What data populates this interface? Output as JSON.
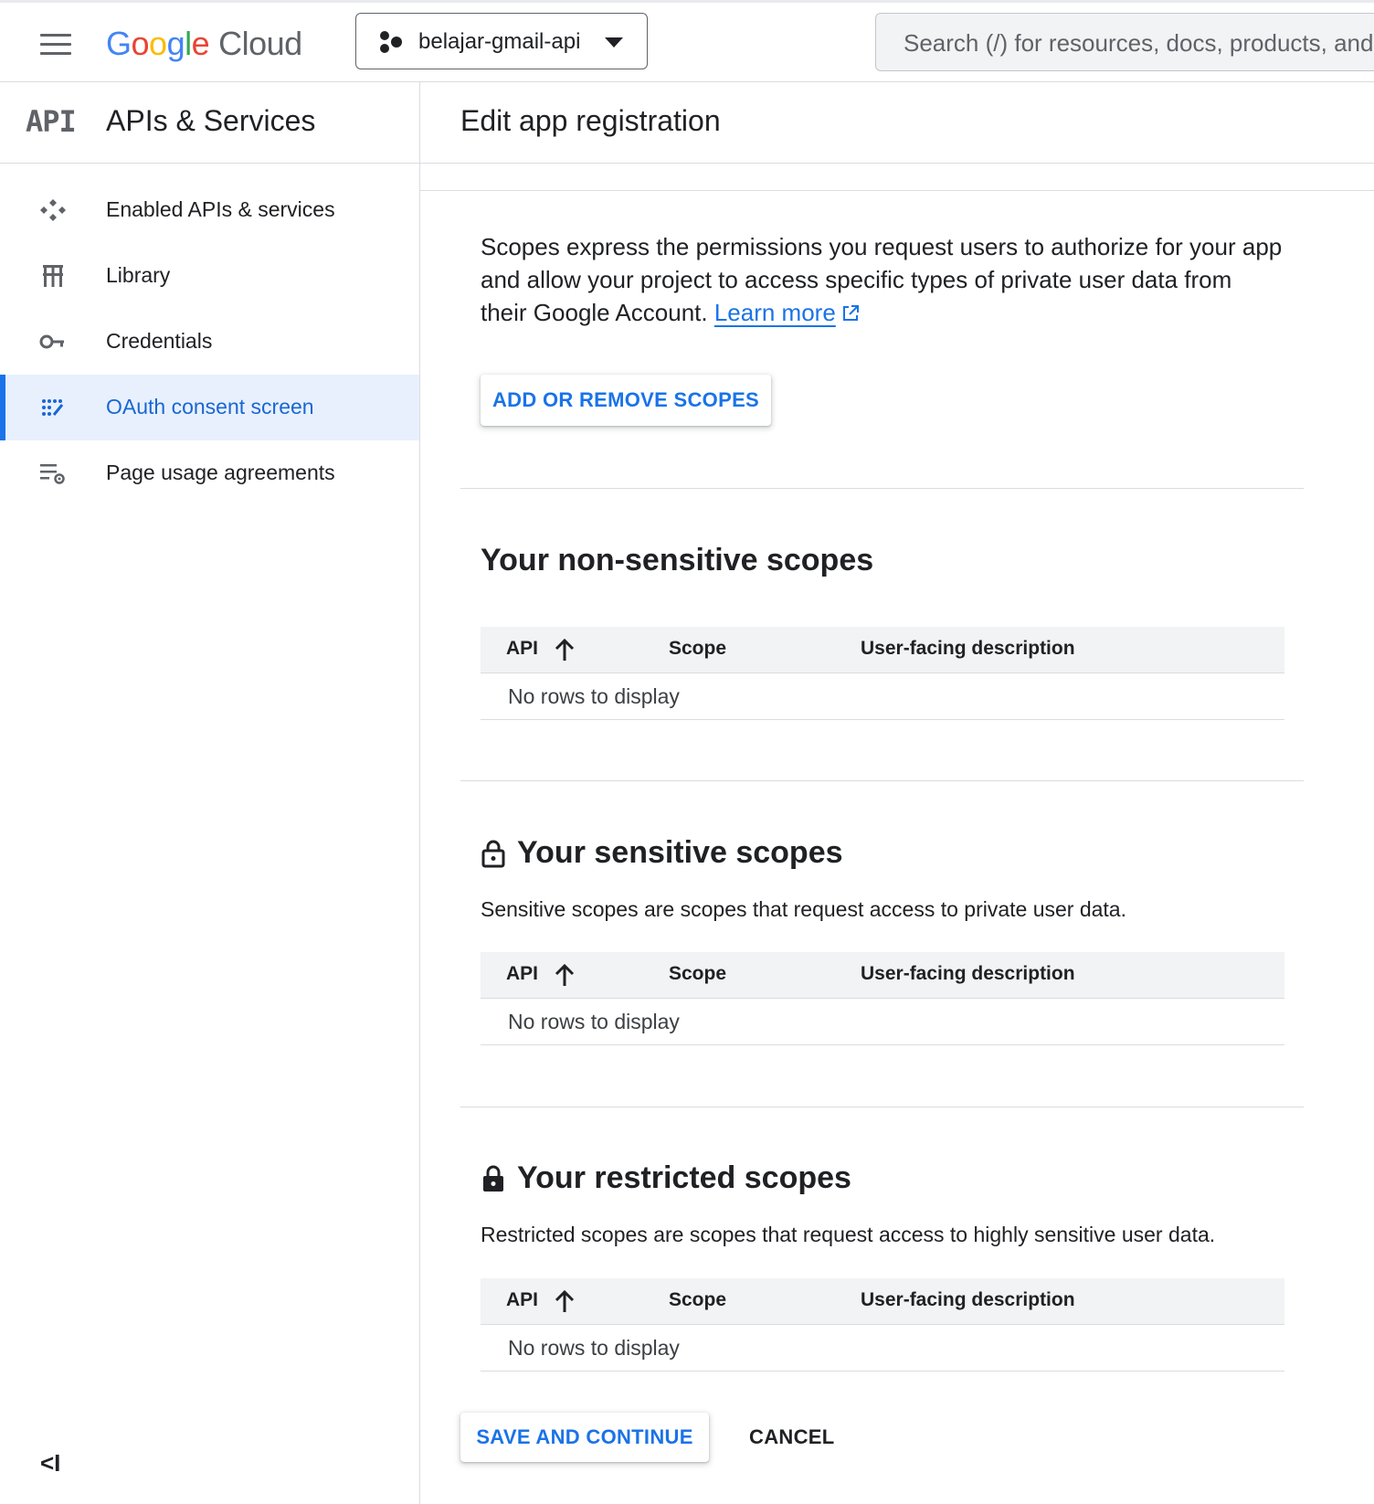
{
  "header": {
    "logo": {
      "google": [
        "G",
        "o",
        "o",
        "g",
        "l",
        "e"
      ],
      "cloud": "Cloud"
    },
    "project_name": "belajar-gmail-api",
    "search_placeholder": "Search (/) for resources, docs, products, and more"
  },
  "sidebar": {
    "logo_text": "API",
    "title": "APIs & Services",
    "items": [
      {
        "label": "Enabled APIs & services",
        "icon": "api-hub-icon"
      },
      {
        "label": "Library",
        "icon": "library-icon"
      },
      {
        "label": "Credentials",
        "icon": "key-icon"
      },
      {
        "label": "OAuth consent screen",
        "icon": "oauth-icon",
        "active": true
      },
      {
        "label": "Page usage agreements",
        "icon": "settings-list-icon"
      }
    ],
    "collapse_label": "<I"
  },
  "main": {
    "title": "Edit app registration",
    "intro_text": "Scopes express the permissions you request users to authorize for your app and allow your project to access specific types of private user data from their Google Account. ",
    "learn_more": "Learn more",
    "add_scopes_button": "ADD OR REMOVE SCOPES",
    "sections": [
      {
        "title": "Your non-sensitive scopes",
        "description": "",
        "icon": ""
      },
      {
        "title": "Your sensitive scopes",
        "description": "Sensitive scopes are scopes that request access to private user data.",
        "icon": "lock-open-icon"
      },
      {
        "title": "Your restricted scopes",
        "description": "Restricted scopes are scopes that request access to highly sensitive user data.",
        "icon": "lock-icon"
      }
    ],
    "table": {
      "columns": [
        "API",
        "Scope",
        "User-facing description"
      ],
      "empty_text": "No rows to display"
    },
    "save_button": "SAVE AND CONTINUE",
    "cancel_button": "CANCEL"
  },
  "colors": {
    "accent": "#1a73e8",
    "active_bg": "#e8f0fe",
    "border": "#dadce0",
    "table_head": "#f1f3f4"
  }
}
